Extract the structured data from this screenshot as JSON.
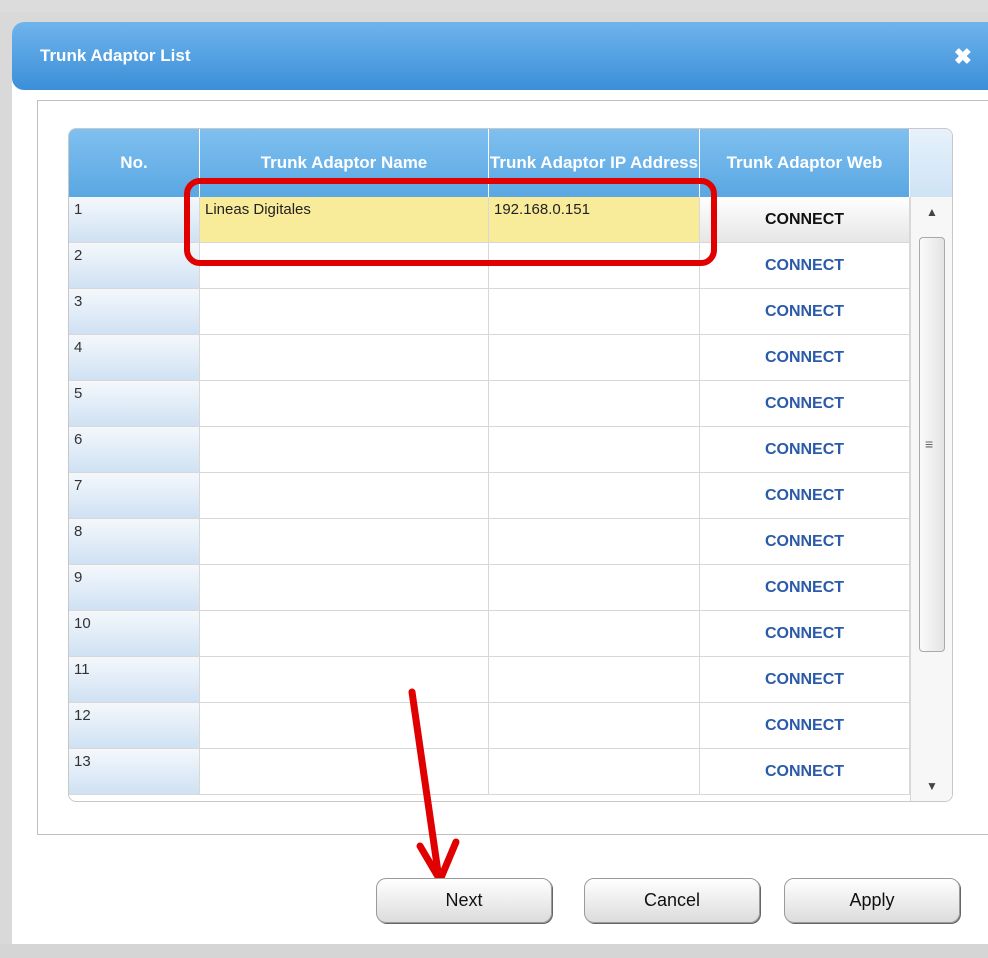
{
  "dialog": {
    "title": "Trunk Adaptor List",
    "close_icon": "close-icon"
  },
  "table": {
    "headers": [
      "No.",
      "Trunk Adaptor Name",
      "Trunk Adaptor IP Address",
      "Trunk Adaptor Web"
    ],
    "rows": [
      {
        "no": "1",
        "name": "Lineas Digitales",
        "ip": "192.168.0.151",
        "web": "CONNECT",
        "selected": true
      },
      {
        "no": "2",
        "name": "",
        "ip": "",
        "web": "CONNECT"
      },
      {
        "no": "3",
        "name": "",
        "ip": "",
        "web": "CONNECT"
      },
      {
        "no": "4",
        "name": "",
        "ip": "",
        "web": "CONNECT"
      },
      {
        "no": "5",
        "name": "",
        "ip": "",
        "web": "CONNECT"
      },
      {
        "no": "6",
        "name": "",
        "ip": "",
        "web": "CONNECT"
      },
      {
        "no": "7",
        "name": "",
        "ip": "",
        "web": "CONNECT"
      },
      {
        "no": "8",
        "name": "",
        "ip": "",
        "web": "CONNECT"
      },
      {
        "no": "9",
        "name": "",
        "ip": "",
        "web": "CONNECT"
      },
      {
        "no": "10",
        "name": "",
        "ip": "",
        "web": "CONNECT"
      },
      {
        "no": "11",
        "name": "",
        "ip": "",
        "web": "CONNECT"
      },
      {
        "no": "12",
        "name": "",
        "ip": "",
        "web": "CONNECT"
      },
      {
        "no": "13",
        "name": "",
        "ip": "",
        "web": "CONNECT"
      }
    ]
  },
  "scrollbar": {
    "up": "▲",
    "down": "▼",
    "grip": "≡"
  },
  "buttons": {
    "next": "Next",
    "cancel": "Cancel",
    "apply": "Apply"
  },
  "colors": {
    "title_bar": "#4a9be0",
    "selected_row": "#f8ec9a",
    "highlight": "#e00000",
    "connect_text": "#2a5aa8"
  }
}
